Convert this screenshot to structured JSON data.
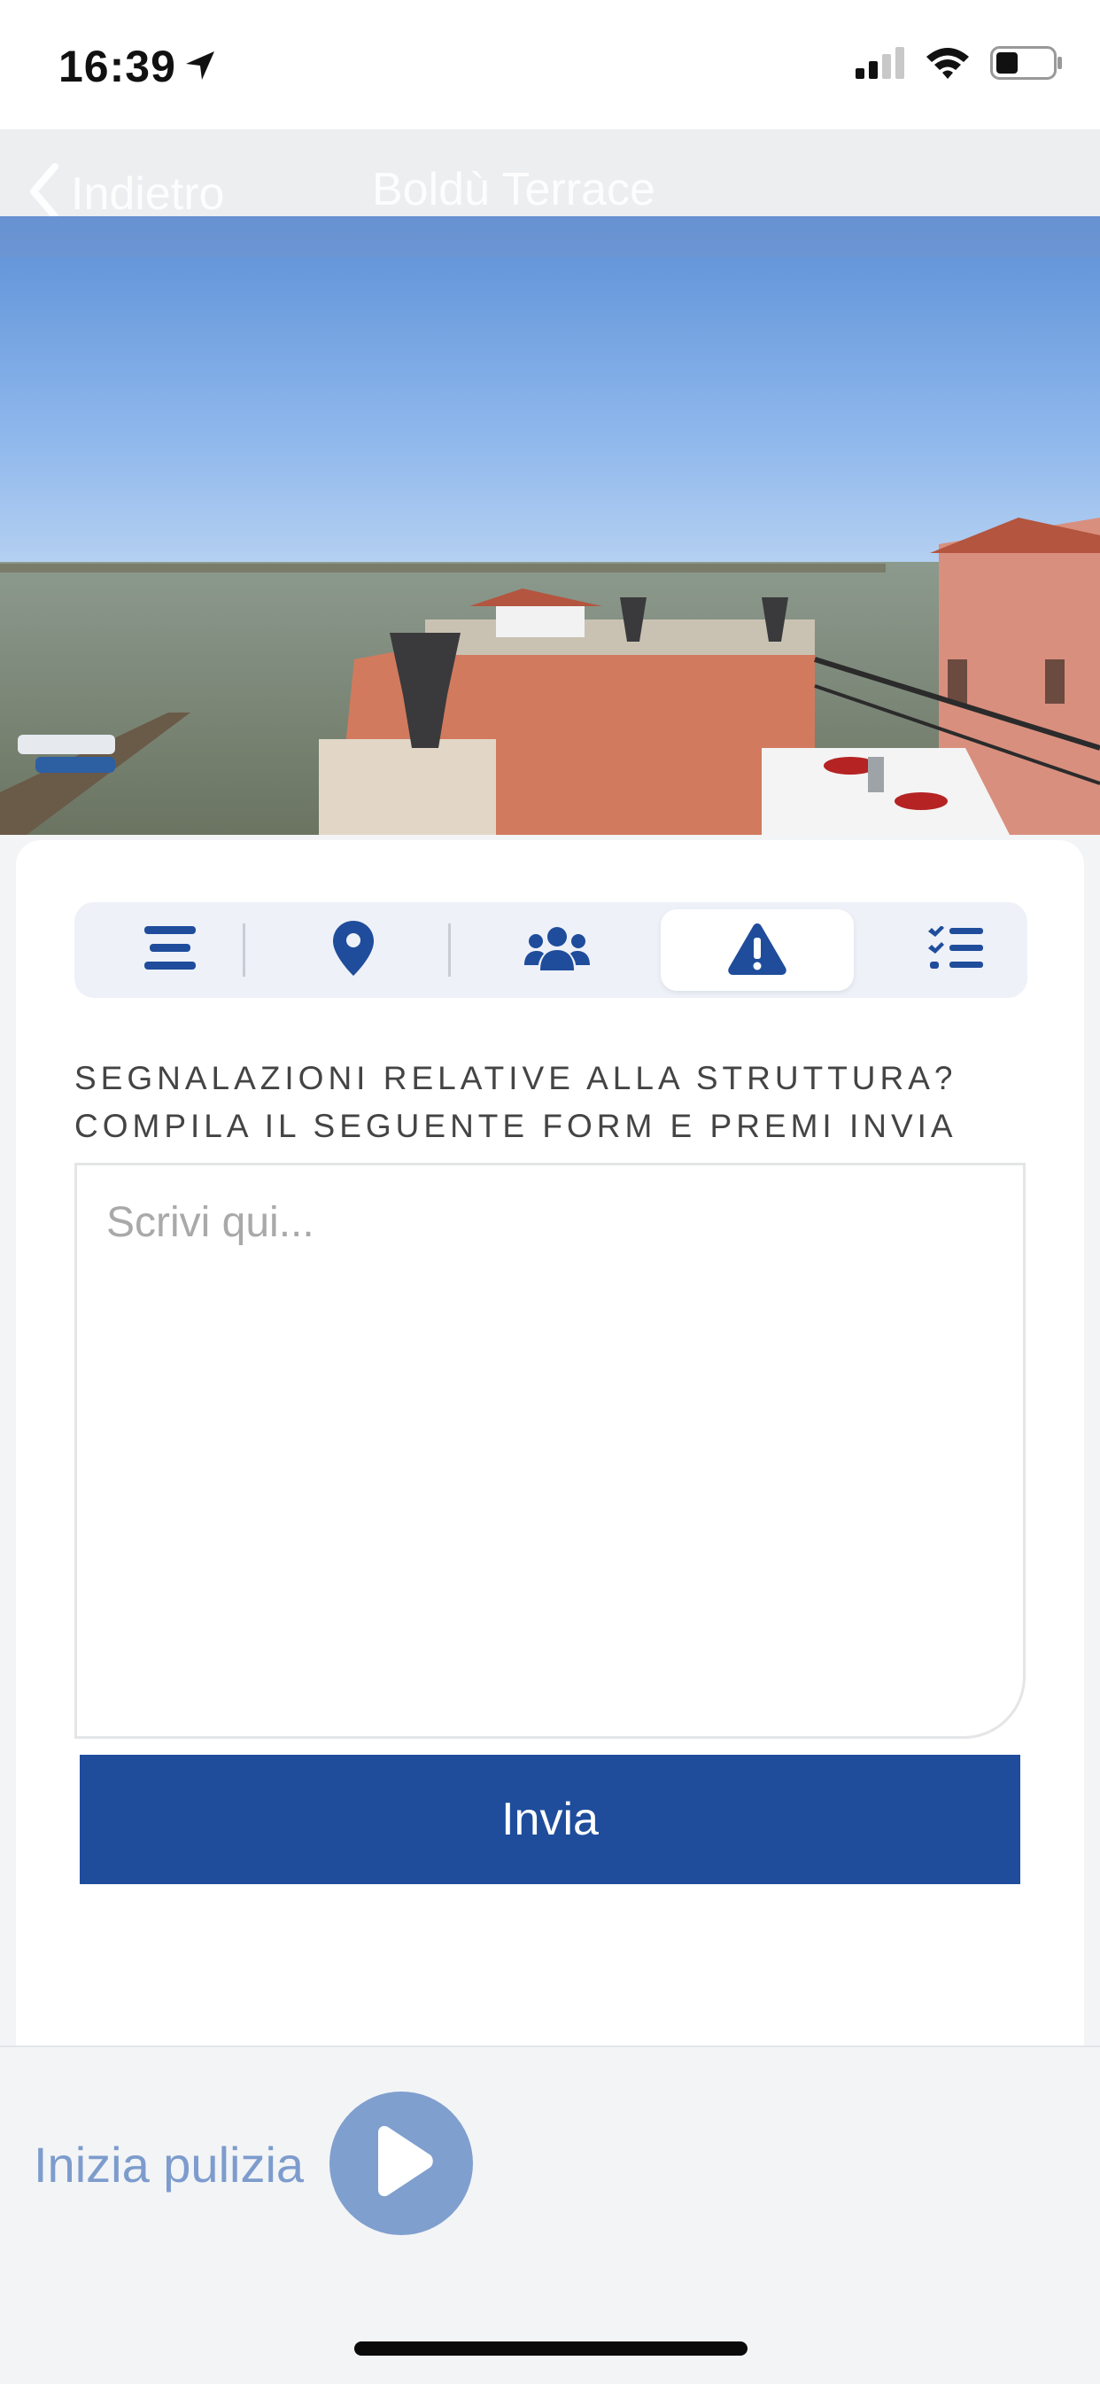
{
  "status_bar": {
    "time": "16:39"
  },
  "nav": {
    "back_label": "Indietro",
    "title": "Boldù Terrace"
  },
  "tabs": [
    {
      "icon": "list-align-icon",
      "active": false
    },
    {
      "icon": "map-pin-icon",
      "active": false
    },
    {
      "icon": "users-icon",
      "active": false
    },
    {
      "icon": "warning-icon",
      "active": true
    },
    {
      "icon": "checklist-icon",
      "active": false
    }
  ],
  "form": {
    "title_line1": "SEGNALAZIONI RELATIVE ALLA STRUTTURA?",
    "title_line2": "COMPILA IL SEGUENTE FORM E PREMI INVIA",
    "placeholder": "Scrivi qui...",
    "submit_label": "Invia"
  },
  "bottom": {
    "start_label": "Inizia pulizia"
  },
  "colors": {
    "accent": "#1f4d9c",
    "muted_accent": "#7f9fcf",
    "background": "#f3f4f6"
  }
}
